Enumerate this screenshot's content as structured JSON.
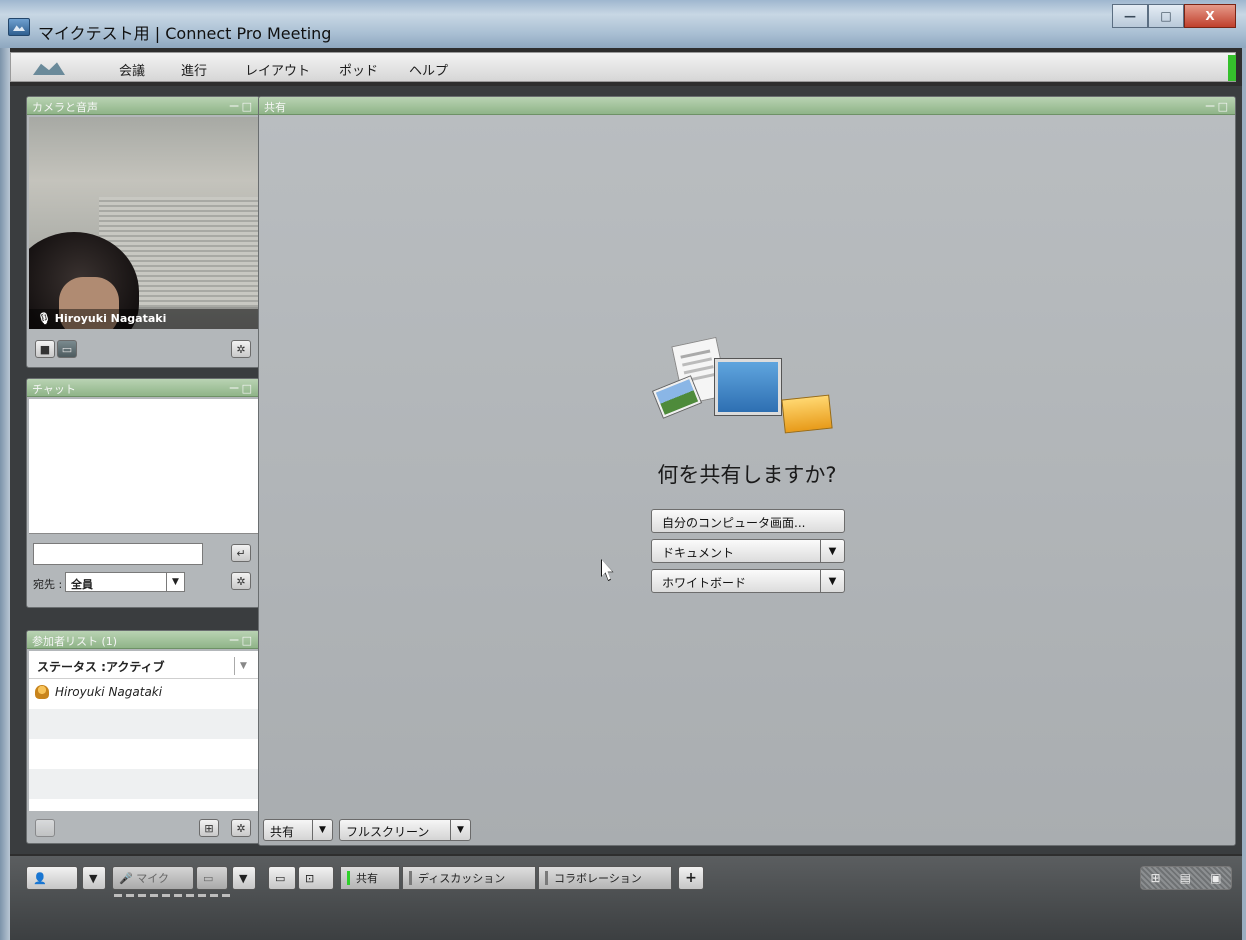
{
  "window": {
    "title": "マイクテスト用 | Connect Pro Meeting",
    "minimize": "—",
    "maximize": "□",
    "close": "X"
  },
  "menu": {
    "items": [
      "会議",
      "進行",
      "レイアウト",
      "ポッド",
      "ヘルプ"
    ]
  },
  "camera_pod": {
    "title": "カメラと音声",
    "controls": "ー□",
    "presenter_name": "Hiroyuki Nagataki"
  },
  "chat_pod": {
    "title": "チャット",
    "controls": "ー□",
    "to_label": "宛先 :",
    "to_value": "全員"
  },
  "attendee_pod": {
    "title": "参加者リスト (1)",
    "controls": "ー□",
    "status_label": "ステータス :アクティブ",
    "attendees": [
      "Hiroyuki Nagataki"
    ]
  },
  "share_pod": {
    "title": "共有",
    "controls": "ー□",
    "question": "何を共有しますか?",
    "options": [
      "自分のコンピュータ画面...",
      "ドキュメント",
      "ホワイトボード"
    ],
    "footer": {
      "share": "共有",
      "fullscreen": "フルスクリーン"
    }
  },
  "bottom_bar": {
    "mic_label": "マイク",
    "tabs": [
      "共有",
      "ディスカッション",
      "コラボレーション"
    ],
    "add": "+"
  }
}
